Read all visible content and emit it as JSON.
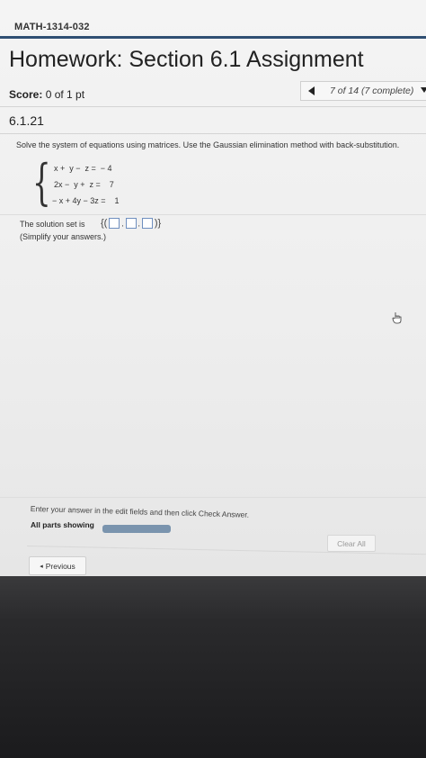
{
  "header": {
    "course": "MATH-1314-032",
    "title": "Homework: Section 6.1 Assignment"
  },
  "score": {
    "label": "Score:",
    "value": "0 of 1 pt"
  },
  "navigation": {
    "position": "7 of 14 (7 complete)"
  },
  "question": {
    "id": "6.1.21",
    "instructions": "Solve the system of equations using matrices. Use the Gaussian elimination method with back-substitution.",
    "equations": [
      "x +  y −  z =  − 4",
      "2x −  y +  z =    7",
      "− x + 4y − 3z =    1"
    ],
    "solution_prefix": "The solution set is",
    "answer_open": "{(",
    "answer_close": ")}",
    "simplify_note": "(Simplify your answers.)"
  },
  "footer": {
    "enter_hint": "Enter your answer in the edit fields and then click Check Answer.",
    "parts_label": "All parts showing",
    "progress_fraction": 0,
    "clear_all_label": "Clear All",
    "previous_label": "Previous"
  },
  "colors": {
    "accent_rule": "#2f4f73",
    "progress_track": "#7a94ae",
    "progress_fill": "#1f7fc6",
    "answer_box_border": "#6f8fbf"
  },
  "icons": {
    "prev_question": "triangle-left-icon",
    "next_question": "triangle-down-icon",
    "cursor": "hand-pointer-icon",
    "previous_button": "bullet-left-icon"
  }
}
